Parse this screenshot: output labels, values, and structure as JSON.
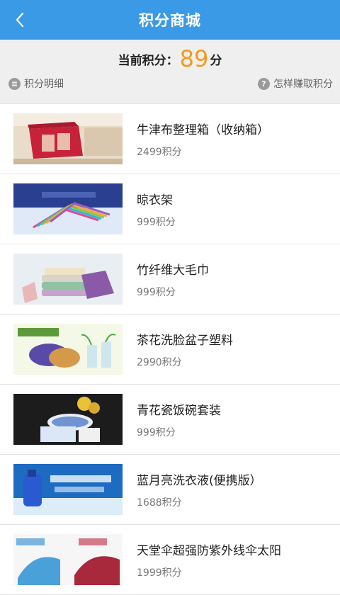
{
  "header": {
    "title": "积分商城"
  },
  "summary": {
    "current_label": "当前积分：",
    "points": "89",
    "unit": "分",
    "detail_link": "积分明细",
    "earn_link": "怎样赚取积分"
  },
  "items": [
    {
      "name": "牛津布整理箱（收纳箱）",
      "price": "2499积分"
    },
    {
      "name": "晾衣架",
      "price": "999积分"
    },
    {
      "name": "竹纤维大毛巾",
      "price": "999积分"
    },
    {
      "name": "茶花洗脸盆子塑料",
      "price": "2990积分"
    },
    {
      "name": "青花瓷饭碗套装",
      "price": "999积分"
    },
    {
      "name": "蓝月亮洗衣液(便携版）",
      "price": "1688积分"
    },
    {
      "name": "天堂伞超强防紫外线伞太阳",
      "price": "1999积分"
    }
  ],
  "colors": {
    "header": "#3a9ae6",
    "points": "#f39a1e"
  }
}
